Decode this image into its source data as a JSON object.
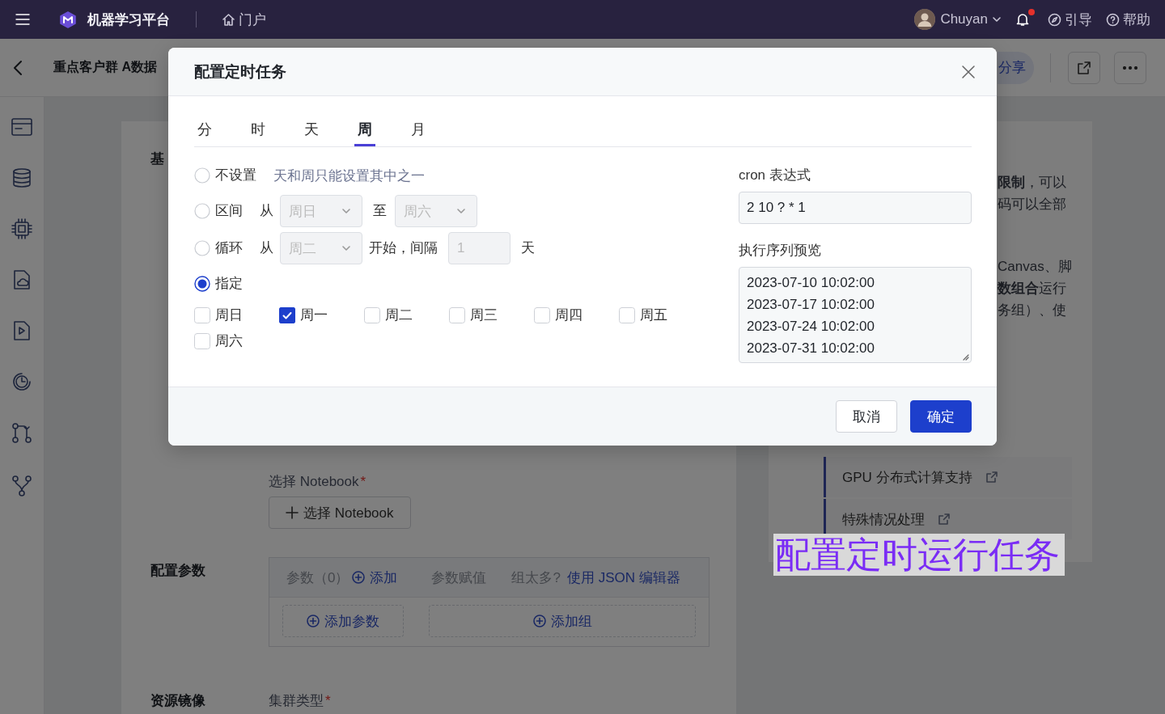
{
  "top_bar": {
    "app_name": "机器学习平台",
    "portal": "门户",
    "user": "Chuyan",
    "unread": true,
    "guide": "引导",
    "help": "帮助"
  },
  "page_header": {
    "title": "重点客户群 A数据",
    "share": "分享"
  },
  "form": {
    "basic_label": "基",
    "notebook_label": "选择 Notebook",
    "required_mark": "*",
    "notebook_button": "选择 Notebook",
    "params_label": "配置参数",
    "params_table": {
      "params_header": "参数（0）",
      "add_link": "添加",
      "value_header": "参数赋值",
      "hint": "组太多?",
      "json_link": "使用 JSON 编辑器",
      "add_param": "添加参数",
      "add_group": "添加组"
    },
    "resource_label": "资源镜像",
    "cluster_label": "集群类型",
    "cluster_required_mark": "*"
  },
  "help_panel": {
    "lines": [
      "**限制**，可以",
      "码可以全部",
      "Canvas、脚",
      "**数组合**运行",
      "务组）、使"
    ],
    "links": [
      {
        "text": "GPU 分布式计算支持"
      },
      {
        "text": "特殊情况处理"
      }
    ]
  },
  "caption": "配置定时运行任务",
  "dialog": {
    "title": "配置定时任务",
    "tabs": [
      {
        "label": "分",
        "selected": false
      },
      {
        "label": "时",
        "selected": false
      },
      {
        "label": "天",
        "selected": false
      },
      {
        "label": "周",
        "selected": true
      },
      {
        "label": "月",
        "selected": false
      }
    ],
    "options": [
      {
        "kind": "none",
        "label": "不设置",
        "hint": "天和周只能设置其中之一",
        "selected": false
      },
      {
        "kind": "range",
        "label": "区间",
        "from": "从",
        "start": "周日",
        "to": "至",
        "end": "周六",
        "selected": false
      },
      {
        "kind": "cycle",
        "label": "循环",
        "from": "从",
        "start": "周二",
        "middle": "开始，间隔",
        "interval": "1",
        "unit": "天",
        "selected": false
      },
      {
        "kind": "specific",
        "label": "指定",
        "selected": true
      }
    ],
    "weekdays": [
      {
        "label": "周日",
        "checked": false
      },
      {
        "label": "周一",
        "checked": true
      },
      {
        "label": "周二",
        "checked": false
      },
      {
        "label": "周三",
        "checked": false
      },
      {
        "label": "周四",
        "checked": false
      },
      {
        "label": "周五",
        "checked": false
      },
      {
        "label": "周六",
        "checked": false
      }
    ],
    "cron_label": "cron 表达式",
    "cron_value": "2 10 ? * 1",
    "preview_label": "执行序列预览",
    "preview": [
      "2023-07-10 10:02:00",
      "2023-07-17 10:02:00",
      "2023-07-24 10:02:00",
      "2023-07-31 10:02:00"
    ],
    "cancel": "取消",
    "ok": "确定"
  }
}
